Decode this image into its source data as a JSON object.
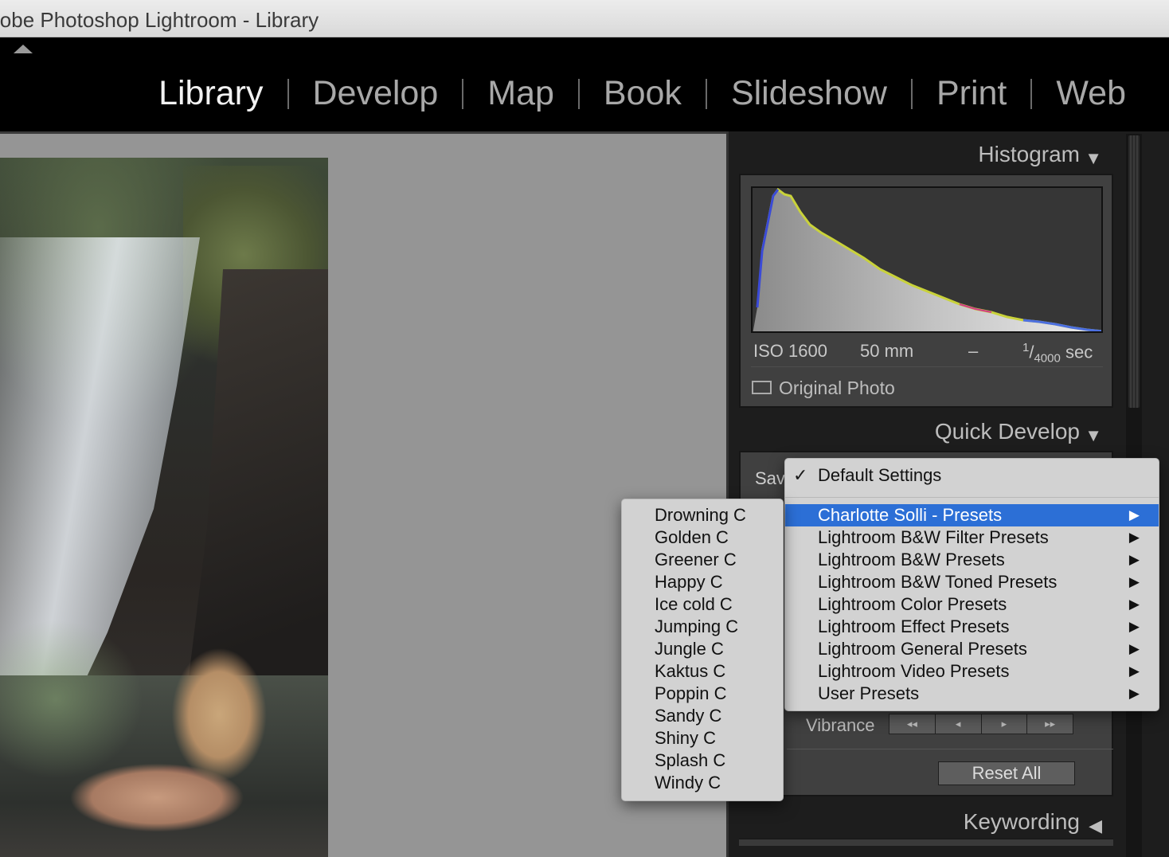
{
  "window": {
    "title": "lobe Photoshop Lightroom - Library"
  },
  "modules": [
    {
      "label": "Library",
      "active": true
    },
    {
      "label": "Develop",
      "active": false
    },
    {
      "label": "Map",
      "active": false
    },
    {
      "label": "Book",
      "active": false
    },
    {
      "label": "Slideshow",
      "active": false
    },
    {
      "label": "Print",
      "active": false
    },
    {
      "label": "Web",
      "active": false
    }
  ],
  "histogram": {
    "title": "Histogram",
    "iso": "ISO 1600",
    "focal": "50 mm",
    "aperture": "–",
    "shutter_num": "1",
    "shutter_den": "4000",
    "shutter_unit": " sec",
    "original_photo_label": "Original Photo"
  },
  "quick_develop": {
    "title": "Quick Develop",
    "saved_preset_label": "Sav",
    "vibrance_label": "Vibrance",
    "vibrance_buttons": [
      "◂◂",
      "◂",
      "▸",
      "▸▸"
    ],
    "reset_label": "Reset All"
  },
  "keywording": {
    "title": "Keywording"
  },
  "preset_menu": {
    "default": "Default Settings",
    "check": "✓",
    "items": [
      {
        "label": "Charlotte Solli - Presets",
        "highlighted": true
      },
      {
        "label": "Lightroom B&W Filter Presets"
      },
      {
        "label": "Lightroom B&W Presets"
      },
      {
        "label": "Lightroom B&W Toned Presets"
      },
      {
        "label": "Lightroom Color Presets"
      },
      {
        "label": "Lightroom Effect Presets"
      },
      {
        "label": "Lightroom General Presets"
      },
      {
        "label": "Lightroom Video Presets"
      },
      {
        "label": "User Presets"
      }
    ],
    "submenu_arrow": "▶"
  },
  "submenu": {
    "items": [
      "Drowning C",
      "Golden C",
      "Greener C",
      "Happy C",
      "Ice cold C",
      "Jumping C",
      "Jungle C",
      "Kaktus C",
      "Poppin C",
      "Sandy C",
      "Shiny C",
      "Splash C",
      "Windy C"
    ]
  },
  "colors": {
    "highlight": "#2c6fd6",
    "panel": "#404040",
    "background": "#959595"
  },
  "icons": {
    "panel_expanded": "triangle-down-icon",
    "panel_collapsed": "triangle-left-icon",
    "filmstrip_toggle": "triangle-up-icon"
  }
}
